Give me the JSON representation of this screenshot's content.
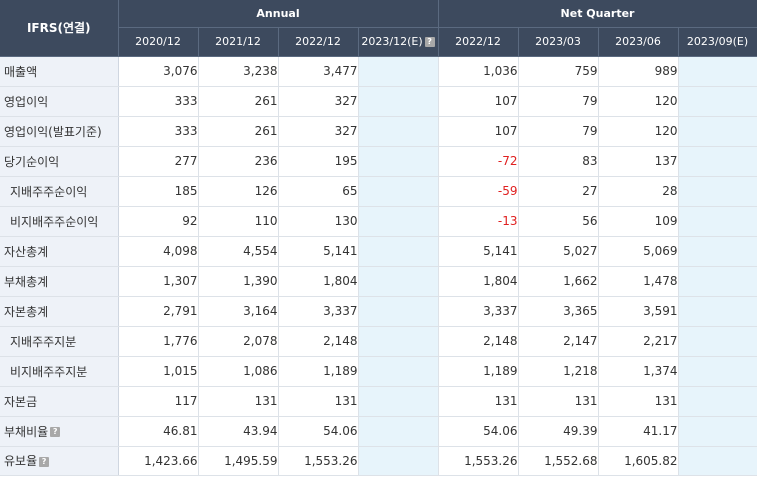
{
  "header": {
    "corner_label": "IFRS(연결)",
    "annual_label": "Annual",
    "quarter_label": "Net Quarter",
    "annual_periods": [
      "2020/12",
      "2021/12",
      "2022/12",
      "2023/12(E)"
    ],
    "quarter_periods": [
      "2022/12",
      "2023/03",
      "2023/06",
      "2023/09(E)"
    ],
    "help_glyph": "?"
  },
  "rows": [
    {
      "label": "매출액",
      "annual": [
        "3,076",
        "3,238",
        "3,477",
        ""
      ],
      "quarter": [
        "1,036",
        "759",
        "989",
        ""
      ]
    },
    {
      "label": "영업이익",
      "annual": [
        "333",
        "261",
        "327",
        ""
      ],
      "quarter": [
        "107",
        "79",
        "120",
        ""
      ]
    },
    {
      "label": "영업이익(발표기준)",
      "annual": [
        "333",
        "261",
        "327",
        ""
      ],
      "quarter": [
        "107",
        "79",
        "120",
        ""
      ]
    },
    {
      "label": "당기순이익",
      "annual": [
        "277",
        "236",
        "195",
        ""
      ],
      "quarter": [
        "-72",
        "83",
        "137",
        ""
      ]
    },
    {
      "label": "지배주주순이익",
      "annual": [
        "185",
        "126",
        "65",
        ""
      ],
      "quarter": [
        "-59",
        "27",
        "28",
        ""
      ]
    },
    {
      "label": "비지배주주순이익",
      "annual": [
        "92",
        "110",
        "130",
        ""
      ],
      "quarter": [
        "-13",
        "56",
        "109",
        ""
      ]
    },
    {
      "label": "자산총계",
      "annual": [
        "4,098",
        "4,554",
        "5,141",
        ""
      ],
      "quarter": [
        "5,141",
        "5,027",
        "5,069",
        ""
      ]
    },
    {
      "label": "부채총계",
      "annual": [
        "1,307",
        "1,390",
        "1,804",
        ""
      ],
      "quarter": [
        "1,804",
        "1,662",
        "1,478",
        ""
      ]
    },
    {
      "label": "자본총계",
      "annual": [
        "2,791",
        "3,164",
        "3,337",
        ""
      ],
      "quarter": [
        "3,337",
        "3,365",
        "3,591",
        ""
      ]
    },
    {
      "label": "지배주주지분",
      "annual": [
        "1,776",
        "2,078",
        "2,148",
        ""
      ],
      "quarter": [
        "2,148",
        "2,147",
        "2,217",
        ""
      ]
    },
    {
      "label": "비지배주주지분",
      "annual": [
        "1,015",
        "1,086",
        "1,189",
        ""
      ],
      "quarter": [
        "1,189",
        "1,218",
        "1,374",
        ""
      ]
    },
    {
      "label": "자본금",
      "annual": [
        "117",
        "131",
        "131",
        ""
      ],
      "quarter": [
        "131",
        "131",
        "131",
        ""
      ]
    },
    {
      "label": "부채비율",
      "annual": [
        "46.81",
        "43.94",
        "54.06",
        ""
      ],
      "quarter": [
        "54.06",
        "49.39",
        "41.17",
        ""
      ]
    },
    {
      "label": "유보율",
      "annual": [
        "1,423.66",
        "1,495.59",
        "1,553.26",
        ""
      ],
      "quarter": [
        "1,553.26",
        "1,552.68",
        "1,605.82",
        ""
      ]
    }
  ],
  "colors": {
    "header_bg": "#3d4a5e",
    "label_bg": "#eef2f8",
    "estimate_bg": "#e7f4fb",
    "negative": "#e02020"
  }
}
